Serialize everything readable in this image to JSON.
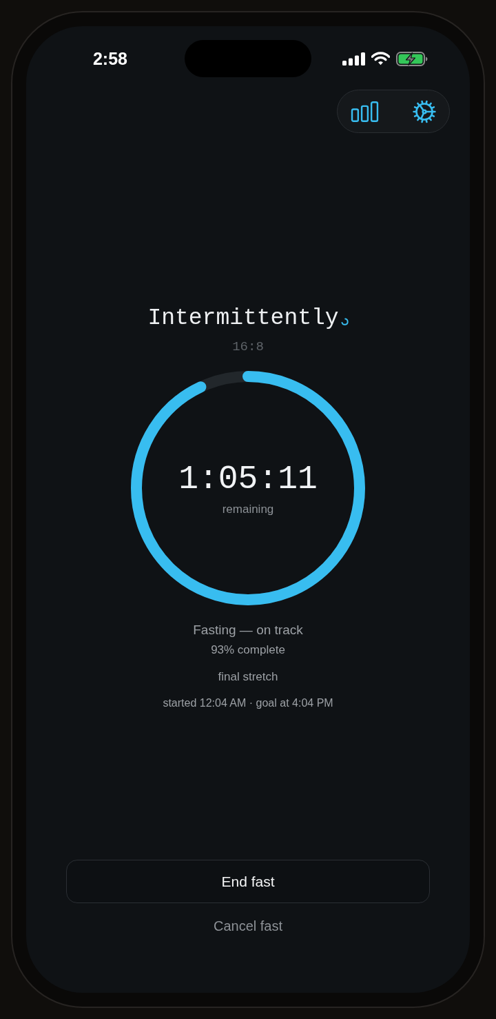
{
  "status_bar": {
    "time": "2:58"
  },
  "header": {
    "title": "Intermittently",
    "plan": "16:8"
  },
  "timer": {
    "level": 0.93,
    "time": "1:05:11",
    "caption": "remaining"
  },
  "status": {
    "headline": "Fasting — on track",
    "progress": "93% complete",
    "phase": "final stretch",
    "schedule": "started 12:04 AM · goal at 4:04 PM"
  },
  "actions": [
    {
      "kind": "primary",
      "label": "End fast"
    },
    {
      "kind": "secondary",
      "label": "Cancel fast"
    }
  ]
}
